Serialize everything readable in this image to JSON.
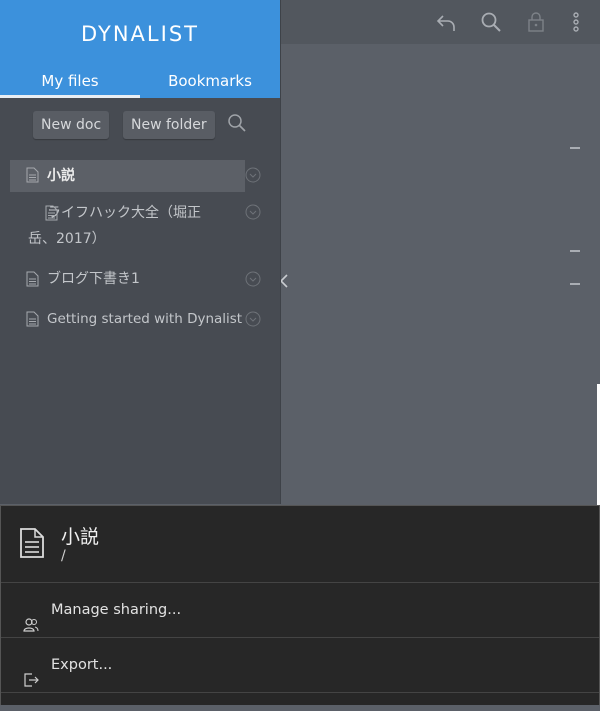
{
  "app": {
    "brand": "DYNALIST"
  },
  "sidebar": {
    "tabs": [
      {
        "label": "My files",
        "active": true
      },
      {
        "label": "Bookmarks",
        "active": false
      }
    ],
    "new_doc_label": "New doc",
    "new_folder_label": "New folder",
    "files": [
      {
        "name": "小説",
        "selected": true
      },
      {
        "name": "ライフハック大全（堀正岳、2017）",
        "selected": false
      },
      {
        "name": "ブログ下書き1",
        "selected": false
      },
      {
        "name": "Getting started with Dynalist",
        "selected": false
      }
    ]
  },
  "toolbar": {
    "icons": [
      "undo-icon",
      "search-icon",
      "lock-icon",
      "more-vertical-icon"
    ]
  },
  "sheet": {
    "title": "小説",
    "path": "/",
    "items": [
      {
        "label": "Manage sharing...",
        "icon": "sharing-icon"
      },
      {
        "label": "Export...",
        "icon": "export-icon"
      }
    ]
  },
  "colors": {
    "brand_blue": "#3c91dc",
    "sidebar_bg": "#474b52",
    "main_bg": "#5b6068",
    "sheet_bg": "#272727"
  }
}
